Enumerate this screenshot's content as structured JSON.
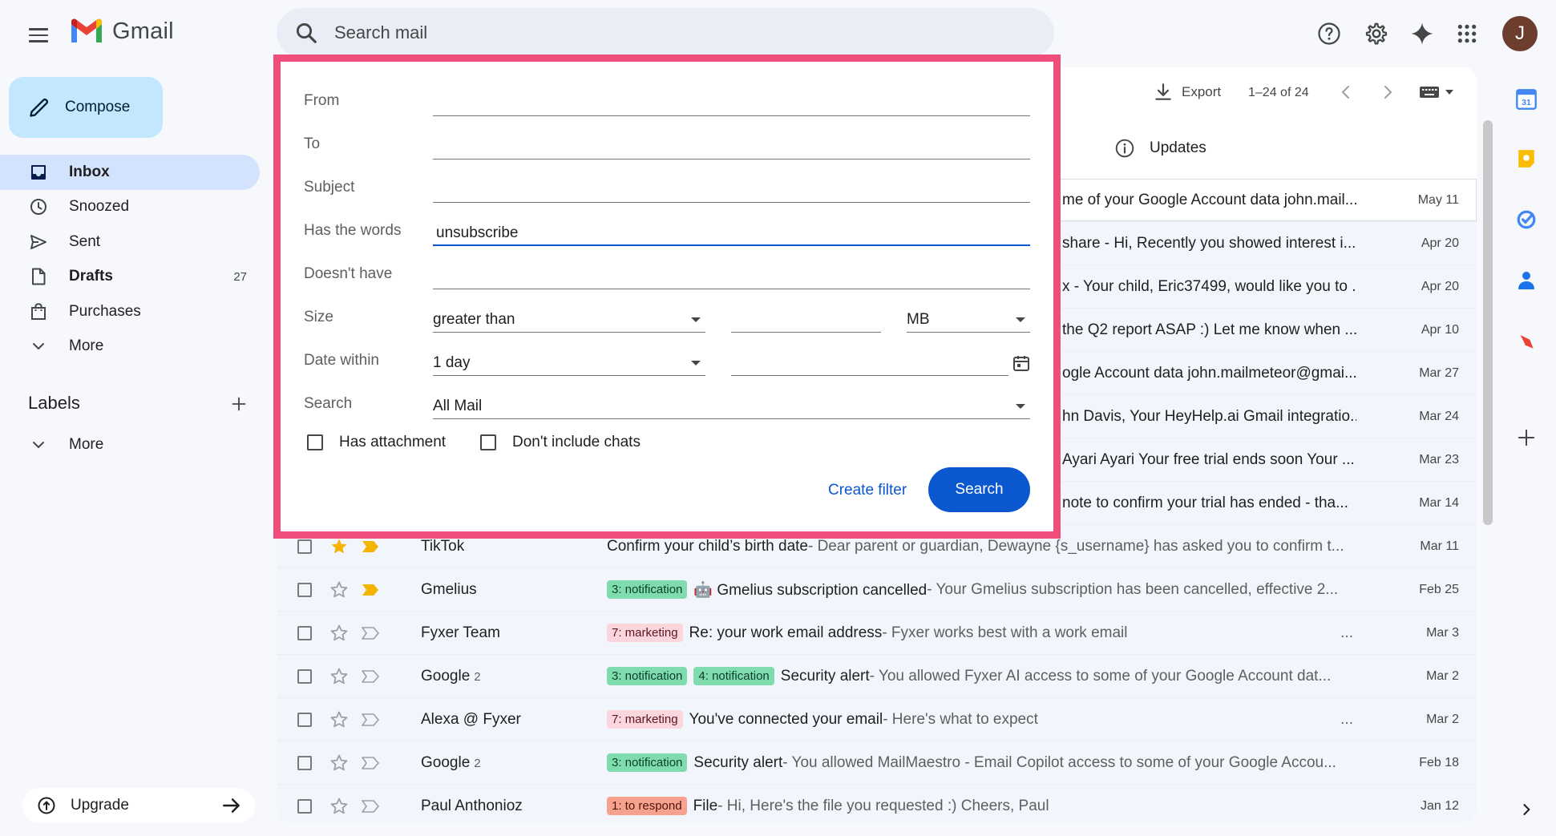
{
  "app": {
    "name": "Gmail"
  },
  "search": {
    "placeholder": "Search mail"
  },
  "user": {
    "initial": "J"
  },
  "sidebar": {
    "compose": "Compose",
    "items": [
      {
        "label": "Inbox",
        "count": "",
        "icon": "inbox-icon"
      },
      {
        "label": "Snoozed",
        "count": "",
        "icon": "clock-icon"
      },
      {
        "label": "Sent",
        "count": "",
        "icon": "send-icon"
      },
      {
        "label": "Drafts",
        "count": "27",
        "icon": "draft-icon"
      },
      {
        "label": "Purchases",
        "count": "",
        "icon": "bag-icon"
      },
      {
        "label": "More",
        "count": "",
        "icon": "chevron-down-icon"
      }
    ],
    "labels_heading": "Labels",
    "labels_more": "More",
    "upgrade": "Upgrade"
  },
  "toolbar": {
    "export": "Export",
    "pager": "1–24 of 24"
  },
  "tabs": {
    "updates": "Updates"
  },
  "emails": [
    {
      "snippet": "me of your Google Account data john.mail...",
      "date": "May 11"
    },
    {
      "snippet": "share - Hi, Recently you showed interest i...",
      "date": "Apr 20"
    },
    {
      "snippet": "x - Your child, Eric37499, would like you to ...",
      "date": "Apr 20"
    },
    {
      "snippet": "the Q2 report ASAP :) Let me know when ...",
      "date": "Apr 10"
    },
    {
      "snippet": "ogle Account data john.mailmeteor@gmai...",
      "date": "Mar 27"
    },
    {
      "snippet": "hn Davis, Your HeyHelp.ai Gmail integratio...",
      "date": "Mar 24"
    },
    {
      "snippet": "Ayari Ayari Your free trial ends soon Your ...",
      "date": "Mar 23"
    },
    {
      "snippet": "note to confirm your trial has ended - tha...",
      "date": "Mar 14"
    },
    {
      "sender": "TikTok",
      "count": "",
      "tags": [],
      "subject": "Confirm your child’s birth date",
      "snippet": " - Dear parent or guardian, Dewayne {s_username} has asked you to confirm t...",
      "date": "Mar 11",
      "starred": true,
      "important": true
    },
    {
      "sender": "Gmelius",
      "count": "",
      "tags": [
        {
          "text": "3: notification",
          "kind": "notif"
        }
      ],
      "subject": "🤖 Gmelius subscription cancelled",
      "snippet": " - Your Gmelius subscription has been cancelled, effective 2...",
      "date": "Feb 25",
      "starred": false,
      "important": true
    },
    {
      "sender": "Fyxer Team",
      "count": "",
      "tags": [
        {
          "text": "7: marketing",
          "kind": "mkt"
        }
      ],
      "subject": "Re: your work email address",
      "snippet": " - Fyxer works best with a work email",
      "ellipsis": "...",
      "date": "Mar 3",
      "starred": false,
      "important": false
    },
    {
      "sender": "Google",
      "count": "2",
      "tags": [
        {
          "text": "3: notification",
          "kind": "notif"
        },
        {
          "text": "4: notification",
          "kind": "notif"
        }
      ],
      "subject": "Security alert",
      "snippet": " - You allowed Fyxer AI access to some of your Google Account dat...",
      "date": "Mar 2",
      "starred": false,
      "important": false
    },
    {
      "sender": "Alexa @ Fyxer",
      "count": "",
      "tags": [
        {
          "text": "7: marketing",
          "kind": "mkt"
        }
      ],
      "subject": "You've connected your email",
      "snippet": " - Here's what to expect",
      "ellipsis": "...",
      "date": "Mar 2",
      "starred": false,
      "important": false
    },
    {
      "sender": "Google",
      "count": "2",
      "tags": [
        {
          "text": "3: notification",
          "kind": "notif"
        }
      ],
      "subject": "Security alert",
      "snippet": " - You allowed MailMaestro - Email Copilot access to some of your Google Accou...",
      "date": "Feb 18",
      "starred": false,
      "important": false
    },
    {
      "sender": "Paul Anthonioz",
      "count": "",
      "tags": [
        {
          "text": "1: to respond",
          "kind": "resp"
        }
      ],
      "subject": "File",
      "snippet": " - Hi, Here's the file you requested :) Cheers, Paul",
      "date": "Jan 12",
      "starred": false,
      "important": false
    }
  ],
  "advanced_search": {
    "from_label": "From",
    "to_label": "To",
    "subject_label": "Subject",
    "has_words_label": "Has the words",
    "has_words_value": "unsubscribe",
    "doesnt_have_label": "Doesn't have",
    "size_label": "Size",
    "size_operator": "greater than",
    "size_unit": "MB",
    "date_within_label": "Date within",
    "date_within_value": "1 day",
    "search_in_label": "Search",
    "search_in_value": "All Mail",
    "has_attachment": "Has attachment",
    "dont_include_chats": "Don't include chats",
    "create_filter": "Create filter",
    "search_button": "Search"
  },
  "colors": {
    "accent": "#0b57d0",
    "compose_bg": "#c2e7ff",
    "highlight_border": "#ef4e7b",
    "star": "#f4b400"
  }
}
